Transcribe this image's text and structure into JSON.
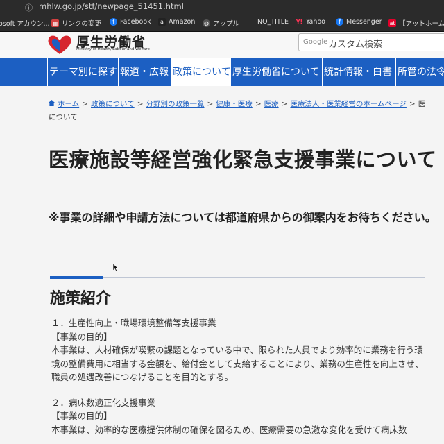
{
  "browser": {
    "url": "mhlw.go.jp/stf/newpage_51451.html",
    "bookmarks": [
      {
        "label": "osoft アカウン...",
        "icon": "microsoft-icon",
        "color": "#666666"
      },
      {
        "label": "リンクの変更",
        "icon": "grid-icon",
        "color": "#d24040"
      },
      {
        "label": "Facebook",
        "icon": "facebook-icon",
        "color": "#1877f2"
      },
      {
        "label": "Amazon",
        "icon": "amazon-icon",
        "color": "#222222"
      },
      {
        "label": "アップル",
        "icon": "globe-icon",
        "color": "#555555"
      },
      {
        "label": "NO_TITLE",
        "icon": "apple-icon",
        "color": "#555555"
      },
      {
        "label": "Yahoo",
        "icon": "yahoo-icon",
        "color": "#ff0033"
      },
      {
        "label": "Messenger",
        "icon": "facebook-icon",
        "color": "#1877f2"
      },
      {
        "label": "【アットホーム】",
        "icon": "athome-icon",
        "color": "#e4002b"
      }
    ]
  },
  "header": {
    "logo_jp": "厚生労働省",
    "logo_en": "Ministry of Health, Labour and Welfare",
    "search_brand": "Google",
    "search_placeholder": "カスタム検索"
  },
  "nav": [
    "テーマ別に探す",
    "報道・広報",
    "政策について",
    "厚生労働省について",
    "統計情報・白書",
    "所管の法令"
  ],
  "breadcrumb": {
    "home": "ホーム",
    "items": [
      "政策について",
      "分野別の政策一覧",
      "健康・医療",
      "医療",
      "医療法人・医業経営のホームページ"
    ],
    "trail": "医",
    "continuation": "について"
  },
  "content": {
    "title": "医療施設等経営強化緊急支援事業について",
    "note": "※事業の詳細や申請方法については都道府県からの御案内をお待ちください。",
    "section_heading": "施策紹介",
    "items": [
      {
        "heading": "１．生産性向上・職場環境整備等支援事業",
        "purpose_label": "【事業の目的】",
        "text": "本事業は、人材確保が喫緊の課題となっている中で、限られた人員でより効率的に業務を行う環境の整備費用に相当する金額を、給付金として支給することにより、業務の生産性を向上させ、職員の処遇改善につなげることを目的とする。"
      },
      {
        "heading": "２．病床数適正化支援事業",
        "purpose_label": "【事業の目的】",
        "text": "本事業は、効率的な医療提供体制の確保を図るため、医療需要の急激な変化を受けて病床数"
      }
    ]
  }
}
